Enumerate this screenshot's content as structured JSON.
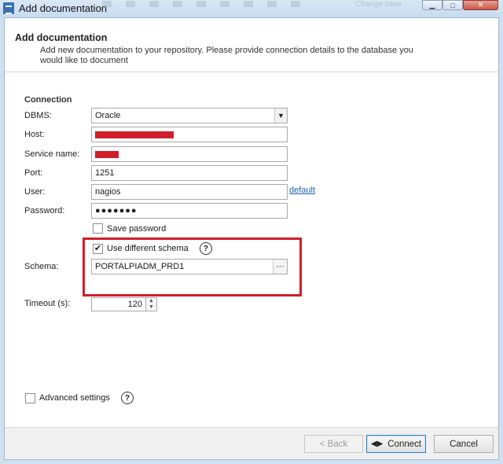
{
  "window": {
    "title": "Add documentation",
    "ghost_toolbar_text": "Change case"
  },
  "header": {
    "title": "Add documentation",
    "description": "Add new documentation to your repository. Please provide connection details to the database you would like to document"
  },
  "connection": {
    "section_title": "Connection",
    "dbms_label": "DBMS:",
    "dbms_value": "Oracle",
    "host_label": "Host:",
    "service_label": "Service name:",
    "port_label": "Port:",
    "port_value": "1251",
    "port_default_link": "default",
    "user_label": "User:",
    "user_value": "nagios",
    "password_label": "Password:",
    "password_value": "●●●●●●●",
    "save_password_label": "Save password",
    "save_password_checked": false,
    "use_schema_label": "Use different schema",
    "use_schema_checked": true,
    "schema_label": "Schema:",
    "schema_value": "PORTALPIADM_PRD1",
    "timeout_label": "Timeout (s):",
    "timeout_value": "120"
  },
  "advanced": {
    "label": "Advanced settings",
    "checked": false
  },
  "footer": {
    "back_label": "< Back",
    "connect_label": "Connect",
    "cancel_label": "Cancel"
  },
  "colors": {
    "highlight": "#d01f2a",
    "link": "#1a61b8"
  },
  "icons": {
    "help": "help-icon",
    "ellipsis": "ellipsis-icon",
    "dropdown": "chevron-down-icon",
    "connect": "connect-icon"
  }
}
